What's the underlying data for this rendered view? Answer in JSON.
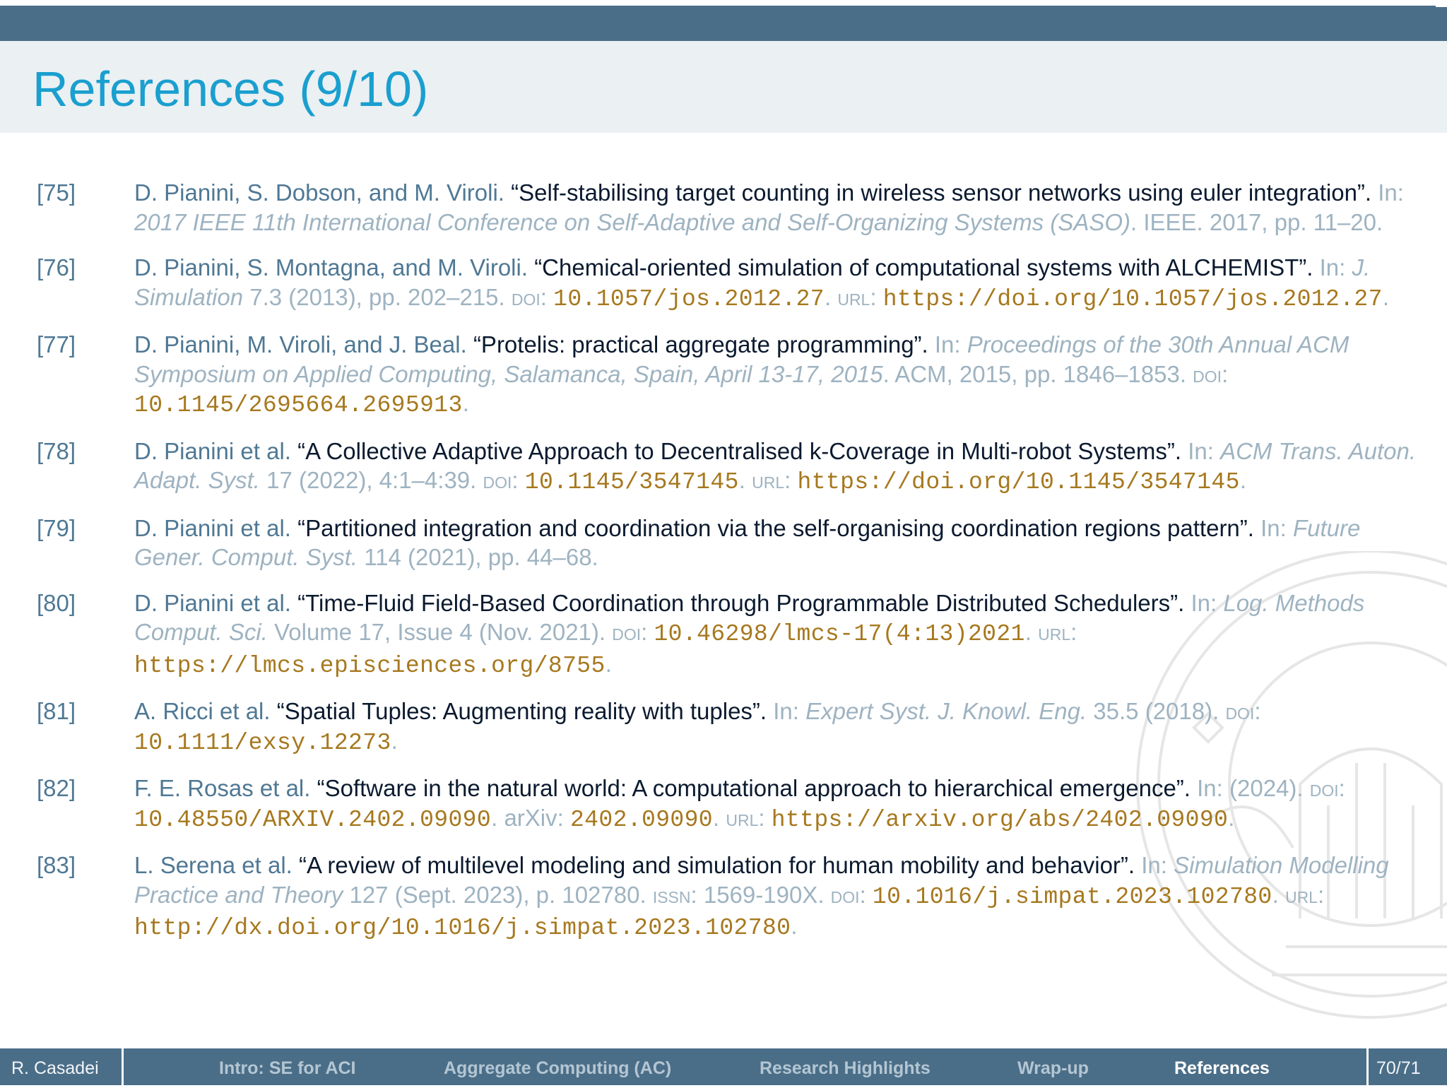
{
  "slide": {
    "title": "References (9/10)"
  },
  "references": [
    {
      "num": "[75]",
      "authors": "D. Pianini, S. Dobson, and M. Viroli.",
      "title": "“Self-stabilising target counting in wireless sensor networks using euler integration”.",
      "in": "In:",
      "venue": "2017 IEEE 11th International Conference on Self-Adaptive and Self-Organizing Systems (SASO)",
      "rest": ". IEEE. 2017, pp. 11–20."
    },
    {
      "num": "[76]",
      "authors": "D. Pianini, S. Montagna, and M. Viroli.",
      "title": "“Chemical-oriented simulation of computational systems with ALCHEMIST”.",
      "in": "In:",
      "venue": "J. Simulation",
      "rest": " 7.3 (2013), pp. 202–215. ",
      "doi_label": "doi",
      "doi": "10.1057/jos.2012.27",
      "url_label": "url",
      "url": "https://doi.org/10.1057/jos.2012.27"
    },
    {
      "num": "[77]",
      "authors": "D. Pianini, M. Viroli, and J. Beal.",
      "title": "“Protelis: practical aggregate programming”.",
      "in": "In:",
      "venue": "Proceedings of the 30th Annual ACM Symposium on Applied Computing, Salamanca, Spain, April 13-17, 2015",
      "rest": ". ACM, 2015, pp. 1846–1853. ",
      "doi_label": "doi",
      "doi": "10.1145/2695664.2695913"
    },
    {
      "num": "[78]",
      "authors": "D. Pianini et al.",
      "title": "“A Collective Adaptive Approach to Decentralised k-Coverage in Multi-robot Systems”.",
      "in": "In:",
      "venue": "ACM Trans. Auton. Adapt. Syst.",
      "rest": " 17 (2022), 4:1–4:39. ",
      "doi_label": "doi",
      "doi": "10.1145/3547145",
      "url_label": "url",
      "url": "https://doi.org/10.1145/3547145"
    },
    {
      "num": "[79]",
      "authors": "D. Pianini et al.",
      "title": "“Partitioned integration and coordination via the self-organising coordination regions pattern”.",
      "in": "In:",
      "venue": "Future Gener. Comput. Syst.",
      "rest": " 114 (2021), pp. 44–68."
    },
    {
      "num": "[80]",
      "authors": "D. Pianini et al.",
      "title": "“Time-Fluid Field-Based Coordination through Programmable Distributed Schedulers”.",
      "in": "In:",
      "venue": "Log. Methods Comput. Sci.",
      "rest": " Volume 17, Issue 4 (Nov. 2021). ",
      "doi_label": "doi",
      "doi": "10.46298/lmcs-17(4:13)2021",
      "url_label": "url",
      "url": "https://lmcs.episciences.org/8755"
    },
    {
      "num": "[81]",
      "authors": "A. Ricci et al.",
      "title": "“Spatial Tuples: Augmenting reality with tuples”.",
      "in": "In:",
      "venue": "Expert Syst. J. Knowl. Eng.",
      "rest": " 35.5 (2018). ",
      "doi_label": "doi",
      "doi": "10.1111/exsy.12273"
    },
    {
      "num": "[82]",
      "authors": "F. E. Rosas et al.",
      "title": "“Software in the natural world: A computational approach to hierarchical emergence”.",
      "in": "In:",
      "venue": "",
      "rest": " (2024). ",
      "doi_label": "doi",
      "doi": "10.48550/ARXIV.2402.09090",
      "arxiv_label": "arXiv",
      "arxiv": "2402.09090",
      "url_label": "url",
      "url": "https://arxiv.org/abs/2402.09090"
    },
    {
      "num": "[83]",
      "authors": "L. Serena et al.",
      "title": "“A review of multilevel modeling and simulation for human mobility and behavior”.",
      "in": "In:",
      "venue": "Simulation Modelling Practice and Theory",
      "rest": " 127 (Sept. 2023), p. 102780. ",
      "issn_label": "issn",
      "issn": "1569-190X",
      "doi_label": "doi",
      "doi": "10.1016/j.simpat.2023.102780",
      "url_label": "url",
      "url": "http://dx.doi.org/10.1016/j.simpat.2023.102780"
    }
  ],
  "footer": {
    "author": "R. Casadei",
    "sections": [
      "Intro: SE for ACI",
      "Aggregate Computing (AC)",
      "Research Highlights",
      "Wrap-up",
      "References"
    ],
    "active_section": "References",
    "page": "70/71"
  },
  "colors": {
    "bar": "#4b6e88",
    "title": "#1a9fcf",
    "author": "#4f7894",
    "link": "#a6781e"
  }
}
